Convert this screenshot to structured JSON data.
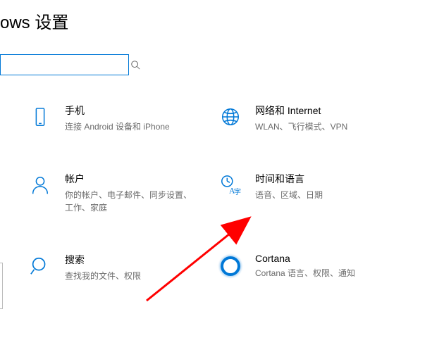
{
  "header": {
    "title": "ows 设置"
  },
  "search": {
    "placeholder": ""
  },
  "items": [
    {
      "title": "手机",
      "desc": "连接 Android 设备和 iPhone"
    },
    {
      "title": "网络和 Internet",
      "desc": "WLAN、飞行模式、VPN"
    },
    {
      "title": "帐户",
      "desc": "你的帐户、电子邮件、同步设置、工作、家庭"
    },
    {
      "title": "时间和语言",
      "desc": "语音、区域、日期"
    },
    {
      "title": "搜索",
      "desc": "查找我的文件、权限"
    },
    {
      "title": "Cortana",
      "desc": "Cortana 语言、权限、通知"
    }
  ]
}
